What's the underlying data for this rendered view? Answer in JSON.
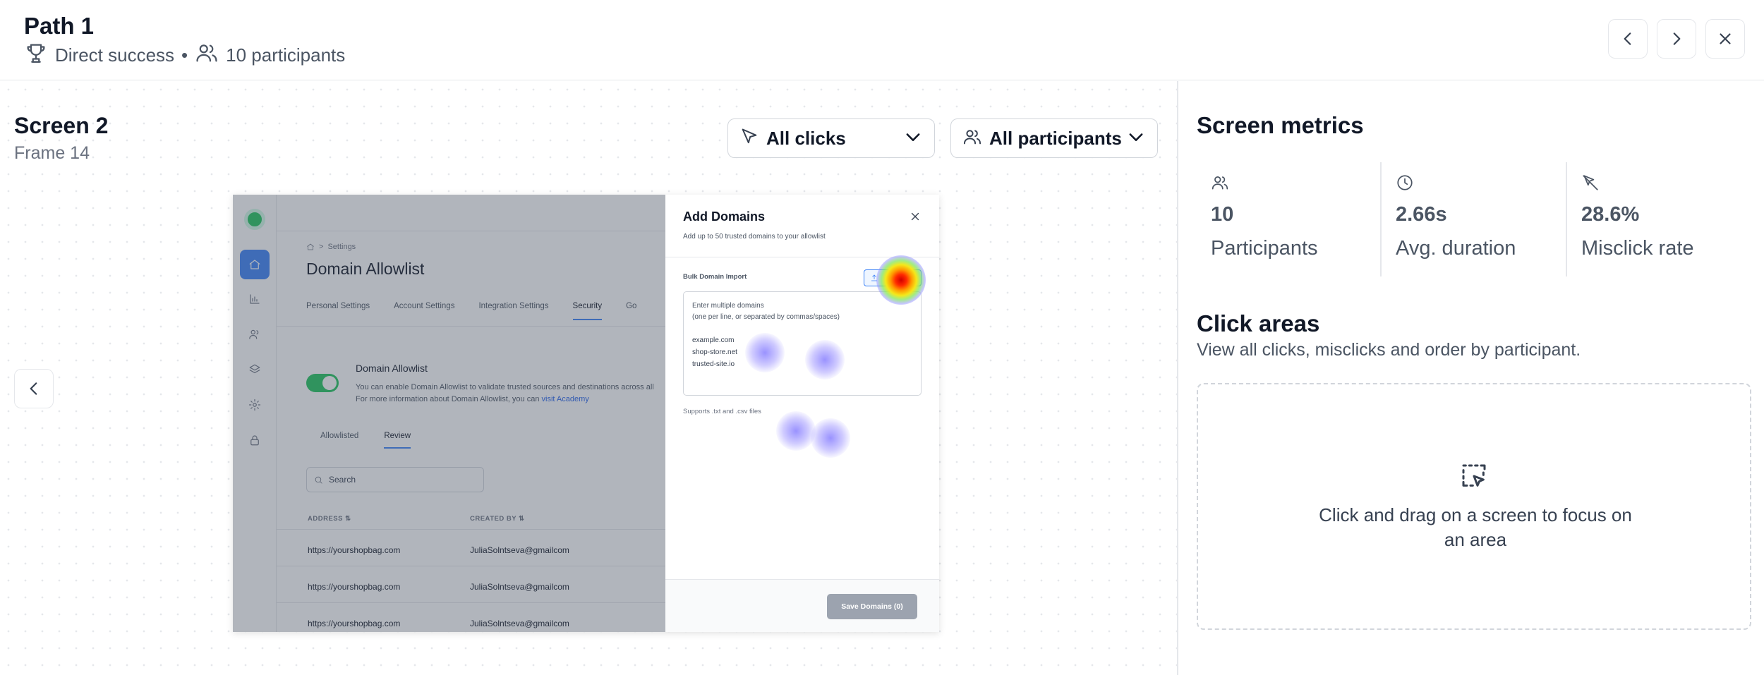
{
  "header": {
    "title": "Path 1",
    "outcome": "Direct success",
    "separator": "•",
    "participants": "10 participants"
  },
  "canvas": {
    "screen_title": "Screen 2",
    "frame_label": "Frame 14",
    "clicks_filter": "All clicks",
    "participants_filter": "All participants"
  },
  "app": {
    "breadcrumb": "Settings",
    "breadcrumb_sep": ">",
    "page_title": "Domain Allowlist",
    "tabs": [
      "Personal Settings",
      "Account Settings",
      "Integration Settings",
      "Security",
      "Go"
    ],
    "toggle_title": "Domain Allowlist",
    "toggle_desc_line1": "You can enable Domain Allowlist to validate trusted sources and destinations across all",
    "toggle_desc_line2": "For more information about Domain Allowlist, you can",
    "toggle_desc_link": "visit Academy",
    "subtabs": [
      "Allowlisted",
      "Review"
    ],
    "search_placeholder": "Search",
    "columns": [
      "ADDRESS ⇅",
      "CREATED BY ⇅"
    ],
    "rows": [
      [
        "https://yourshopbag.com",
        "JuliaSolntseva@gmailcom"
      ],
      [
        "https://yourshopbag.com",
        "JuliaSolntseva@gmailcom"
      ],
      [
        "https://yourshopbag.com",
        "JuliaSolntseva@gmailcom"
      ]
    ]
  },
  "modal": {
    "title": "Add Domains",
    "subtitle": "Add up to 50 trusted domains to your allowlist",
    "bulk_label": "Bulk Domain Import",
    "textarea_hint1": "Enter multiple domains",
    "textarea_hint2": "(one per line, or separated by commas/spaces)",
    "examples": [
      "example.com",
      "shop-store.net",
      "trusted-site.io"
    ],
    "supports": "Supports .txt and .csv files",
    "save_button": "Save Domains (0)"
  },
  "metrics": {
    "title": "Screen metrics",
    "items": [
      {
        "value": "10",
        "label": "Participants",
        "icon": "users-icon"
      },
      {
        "value": "2.66s",
        "label": "Avg. duration",
        "icon": "clock-icon"
      },
      {
        "value": "28.6%",
        "label": "Misclick rate",
        "icon": "misclick-icon"
      }
    ]
  },
  "click_areas": {
    "title": "Click areas",
    "subtitle": "View all clicks, misclicks and order by participant.",
    "drop_text": "Click and drag on a screen to focus on an area"
  }
}
